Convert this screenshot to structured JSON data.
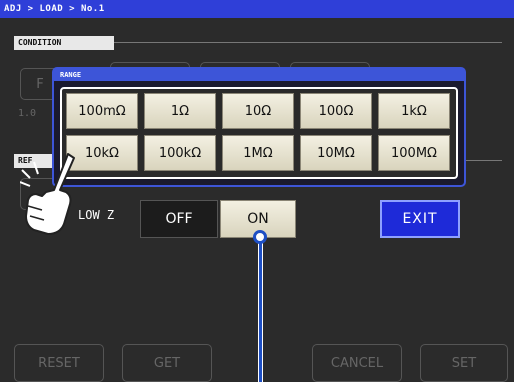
{
  "breadcrumb": "ADJ > LOAD > No.1",
  "condition_tab": "CONDITION",
  "ref_tab": "REF",
  "bg_fragments": {
    "f_key": "F",
    "value": "1.0"
  },
  "range": {
    "title": "RANGE",
    "buttons": [
      "100mΩ",
      "1Ω",
      "10Ω",
      "100Ω",
      "1kΩ",
      "10kΩ",
      "100kΩ",
      "1MΩ",
      "10MΩ",
      "100MΩ"
    ]
  },
  "low_z": {
    "label": "LOW Z",
    "off": "OFF",
    "on": "ON",
    "selected": "ON"
  },
  "exit_label": "EXIT",
  "bottom_buttons": {
    "reset": "RESET",
    "get": "GET",
    "cancel": "CANCEL",
    "set": "SET"
  },
  "colors": {
    "title_bar": "#2f3fd8",
    "range_border": "#3d55d8",
    "exit": "#1e2ad8",
    "callout": "#1e4fc4"
  },
  "icons": [
    "pointing-hand-icon",
    "callout-marker"
  ]
}
